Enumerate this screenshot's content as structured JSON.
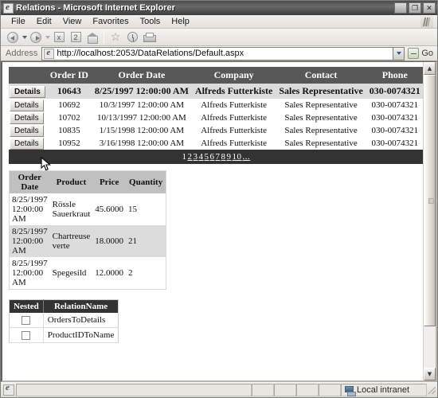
{
  "window": {
    "title": "Relations - Microsoft Internet Explorer",
    "icon": "ie-document-icon",
    "minimize_label": "_",
    "maximize_label": "❐",
    "close_label": "✕"
  },
  "menubar": {
    "items": [
      {
        "label": "File"
      },
      {
        "label": "Edit"
      },
      {
        "label": "View"
      },
      {
        "label": "Favorites"
      },
      {
        "label": "Tools"
      },
      {
        "label": "Help"
      }
    ],
    "brand_icon": "ie-brand-icon"
  },
  "toolbar": {
    "buttons": [
      {
        "name": "back-icon",
        "label": ""
      },
      {
        "name": "forward-icon",
        "label": ""
      },
      {
        "name": "stop-icon",
        "label": "x"
      },
      {
        "name": "refresh-icon",
        "label": "2"
      },
      {
        "name": "home-icon",
        "label": ""
      },
      {
        "name": "favorites-star-icon",
        "label": "☆"
      },
      {
        "name": "history-icon",
        "label": ""
      },
      {
        "name": "print-icon",
        "label": ""
      }
    ]
  },
  "address_bar": {
    "label": "Address",
    "url": "http://localhost:2053/DataRelations/Default.aspx",
    "placeholder": "",
    "dropdown_glyph": "⌄",
    "go_label": "Go",
    "page_icon": "ie-page-icon"
  },
  "orders_grid": {
    "columns": [
      "",
      "Order ID",
      "Order Date",
      "Company",
      "Contact",
      "Phone"
    ],
    "button_label": "Details",
    "rows": [
      {
        "selected": true,
        "order_id": "10643",
        "order_date": "8/25/1997 12:00:00 AM",
        "company": "Alfreds Futterkiste",
        "contact": "Sales Representative",
        "phone": "030-0074321"
      },
      {
        "selected": false,
        "order_id": "10692",
        "order_date": "10/3/1997 12:00:00 AM",
        "company": "Alfreds Futterkiste",
        "contact": "Sales Representative",
        "phone": "030-0074321"
      },
      {
        "selected": false,
        "order_id": "10702",
        "order_date": "10/13/1997 12:00:00 AM",
        "company": "Alfreds Futterkiste",
        "contact": "Sales Representative",
        "phone": "030-0074321"
      },
      {
        "selected": false,
        "order_id": "10835",
        "order_date": "1/15/1998 12:00:00 AM",
        "company": "Alfreds Futterkiste",
        "contact": "Sales Representative",
        "phone": "030-0074321"
      },
      {
        "selected": false,
        "order_id": "10952",
        "order_date": "3/16/1998 12:00:00 AM",
        "company": "Alfreds Futterkiste",
        "contact": "Sales Representative",
        "phone": "030-0074321"
      }
    ],
    "pager": {
      "current_page": "1",
      "links": [
        "2",
        "3",
        "4",
        "5",
        "6",
        "7",
        "8",
        "9",
        "10",
        "..."
      ]
    }
  },
  "details_grid": {
    "columns": [
      "Order Date",
      "Product",
      "Price",
      "Quantity"
    ],
    "rows": [
      {
        "order_date": "8/25/1997 12:00:00 AM",
        "product": "Rössle Sauerkraut",
        "price": "45.6000",
        "quantity": "15"
      },
      {
        "order_date": "8/25/1997 12:00:00 AM",
        "product": "Chartreuse verte",
        "price": "18.0000",
        "quantity": "21"
      },
      {
        "order_date": "8/25/1997 12:00:00 AM",
        "product": "Spegesild",
        "price": "12.0000",
        "quantity": "2"
      }
    ]
  },
  "relations_grid": {
    "columns": [
      "Nested",
      "RelationName"
    ],
    "rows": [
      {
        "nested": false,
        "relation_name": "OrdersToDetails"
      },
      {
        "nested": false,
        "relation_name": "ProductIDToName"
      }
    ]
  },
  "status_bar": {
    "page_icon": "ie-page-icon",
    "message": "",
    "zone": "Local intranet",
    "zone_icon": "network-zone-icon"
  },
  "scrollbar": {
    "up_glyph": "▲",
    "down_glyph": "▼"
  },
  "colors": {
    "header_dark": "#585858",
    "pager_dark": "#333333",
    "selected_row": "#dcdcdc",
    "details_header": "#c0c0c0"
  }
}
